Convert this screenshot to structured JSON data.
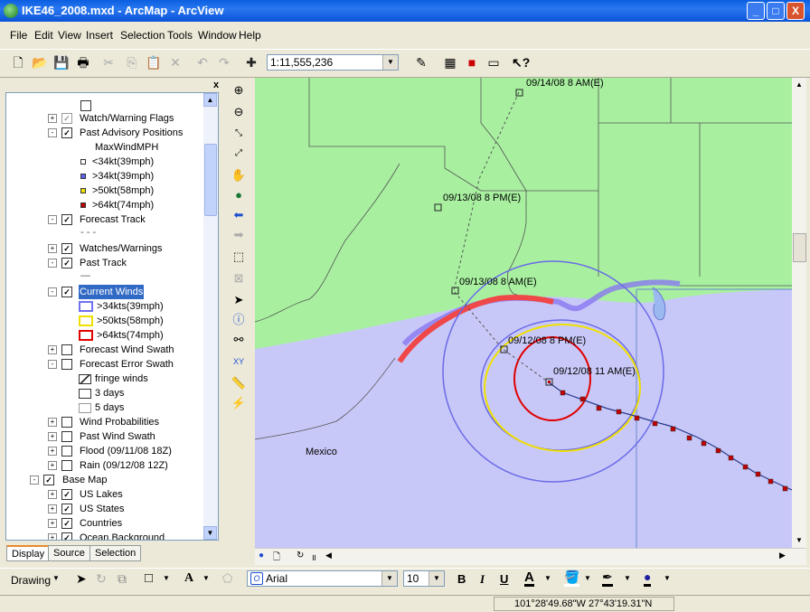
{
  "window": {
    "title": "IKE46_2008.mxd - ArcMap - ArcView",
    "min_label": "_",
    "max_label": "□",
    "close_label": "X"
  },
  "menu": [
    "File",
    "Edit",
    "View",
    "Insert",
    "Selection",
    "Tools",
    "Window",
    "Help"
  ],
  "toolbar": {
    "scale": "1:11,555,236"
  },
  "toc": {
    "items": [
      {
        "label": "Watch/Warning Flags",
        "checked": true,
        "expander": "+"
      },
      {
        "label": "Past Advisory Positions",
        "checked": true,
        "expander": "-"
      },
      {
        "label": "MaxWindMPH"
      },
      {
        "label": "<34kt(39mph)"
      },
      {
        "label": ">34kt(39mph)"
      },
      {
        "label": ">50kt(58mph)"
      },
      {
        "label": ">64kt(74mph)"
      },
      {
        "label": "Forecast Track",
        "checked": true,
        "expander": "-"
      },
      {
        "label": "- - -"
      },
      {
        "label": "Watches/Warnings",
        "checked": true,
        "expander": "+"
      },
      {
        "label": "Past Track",
        "checked": true,
        "expander": "-"
      },
      {
        "label": "—"
      },
      {
        "label": "Current Winds",
        "checked": true,
        "expander": "-"
      },
      {
        "label": ">34kts(39mph)"
      },
      {
        "label": ">50kts(58mph)"
      },
      {
        "label": ">64kts(74mph)"
      },
      {
        "label": "Forecast Wind Swath",
        "checked": false,
        "expander": "+"
      },
      {
        "label": "Forecast Error Swath",
        "checked": false,
        "expander": "-"
      },
      {
        "label": "fringe winds"
      },
      {
        "label": "3 days"
      },
      {
        "label": "5 days"
      },
      {
        "label": "Wind Probabilities",
        "checked": false,
        "expander": "+"
      },
      {
        "label": "Past Wind Swath",
        "checked": false,
        "expander": "+"
      },
      {
        "label": "Flood (09/11/08  18Z)",
        "checked": false,
        "expander": "+"
      },
      {
        "label": "Rain (09/12/08 12Z)",
        "checked": false,
        "expander": "+"
      },
      {
        "label": "Base Map",
        "checked": true,
        "expander": "-"
      },
      {
        "label": "US Lakes",
        "checked": true,
        "expander": "+"
      },
      {
        "label": "US States",
        "checked": true,
        "expander": "+"
      },
      {
        "label": "Countries",
        "checked": true,
        "expander": "+"
      },
      {
        "label": "Ocean Background",
        "checked": true,
        "expander": "+"
      }
    ],
    "tabs": [
      "Display",
      "Source",
      "Selection"
    ],
    "close_label": "x"
  },
  "map": {
    "labels": [
      "09/14/08 8 AM(E)",
      "09/13/08 8 PM(E)",
      "09/13/08 8 AM(E)",
      "09/12/08 8 PM(E)",
      "09/12/08 11 AM(E)",
      "Mexico"
    ],
    "colors": {
      "land": "#a8f0a0",
      "ocean": "#c8c8f8",
      "wind34": "#7070f0",
      "wind50": "#f0e000",
      "wind64": "#e00000",
      "track": "#2a3a8a",
      "warning": "#f04848"
    }
  },
  "drawing": {
    "label": "Drawing",
    "font": "Arial",
    "size": "10",
    "bold": "B",
    "italic": "I",
    "underline": "U",
    "text_color": "A"
  },
  "status": {
    "coords": "101°28'49.68\"W  27°43'19.31\"N"
  }
}
